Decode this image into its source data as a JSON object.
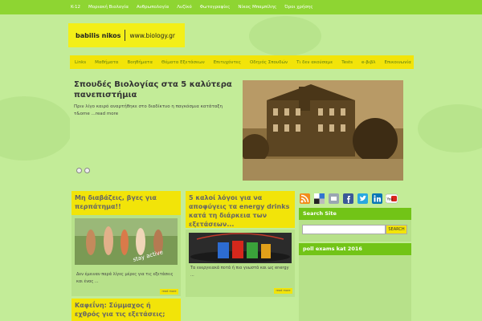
{
  "top_nav": [
    "K-12",
    "Μοριακή Βιολογία",
    "Ανθρωπολογία",
    "Λυζίκό",
    "Φωτογραφίες",
    "Νίκος Μπαμπίλης",
    "Όροι χρήσης"
  ],
  "logo": {
    "name": "babilis nikos",
    "site": "www.biology.gr"
  },
  "main_nav": [
    "Links",
    "Μαθήματα",
    "Βοηθήματα",
    "Θέματα Εξετάσεων",
    "Επιτυχόντες",
    "Οδηγός Σπουδών",
    "Τι δεν ακούσαμε",
    "Tests",
    "e-βιβλ",
    "Επικοινωνία"
  ],
  "feature": {
    "title": "Σπουδές Βιολογίας στα 5 καλύτερα πανεπιστήμια",
    "excerpt": "Πριν λίγο καιρό αναρτήθηκε στο διαδίκτυο η παγκόσμια κατάταξη τ&ome ...",
    "more": "read more"
  },
  "cards": [
    {
      "title": "Μη διαβάζεις, βγες για περπάτημα!!",
      "text": "Δεν έμειναν παρά λίγες μέρες για τις εξετάσεις και ένας ...",
      "readmore": "read more",
      "img_caption": "stay active"
    },
    {
      "title": "5 καλοί λόγοι για να αποφύγεις τα energy drinks κατά τη διάρκεια των εξετάσεων...",
      "text": "Τα ενεργειακά ποτά ή πιο γνωστά και ως energy ...",
      "readmore": "read more"
    },
    {
      "title": "Καφεΐνη: Σύμμαχος ή εχθρός για τις εξετάσεις;"
    }
  ],
  "sidebar": {
    "search_head": "Search Site",
    "search_button": "SEARCH",
    "poll_head": "poll exams kat 2016",
    "social_icons": [
      "rss-icon",
      "delicious-icon",
      "digg-icon",
      "facebook-icon",
      "twitter-icon",
      "linkedin-icon",
      "youtube-icon"
    ]
  },
  "colors": {
    "background": "#c3ec98",
    "topbar": "#8ed532",
    "yellow": "#f2e409",
    "green_head": "#72c417"
  }
}
